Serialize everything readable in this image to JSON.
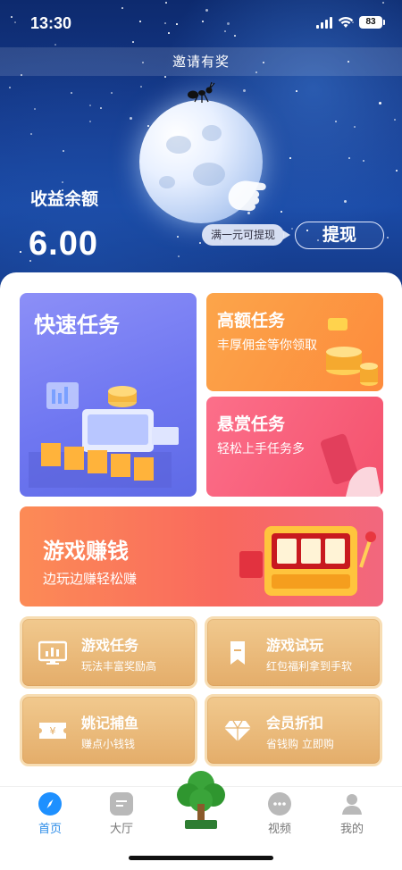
{
  "status_bar": {
    "time": "13:30",
    "battery": "83"
  },
  "header": {
    "invite_text": "邀请有奖"
  },
  "balance": {
    "label": "收益余额",
    "value": "6.00",
    "tip": "满一元可提现",
    "withdraw_label": "提现"
  },
  "cards": {
    "quick": {
      "title": "快速任务"
    },
    "high": {
      "title": "高额任务",
      "subtitle": "丰厚佣金等你领取"
    },
    "reward": {
      "title": "悬赏任务",
      "subtitle": "轻松上手任务多"
    },
    "game": {
      "title": "游戏赚钱",
      "subtitle": "边玩边赚轻松赚"
    }
  },
  "grid": [
    {
      "title": "游戏任务",
      "subtitle": "玩法丰富奖励高",
      "icon": "monitor-chart-icon"
    },
    {
      "title": "游戏试玩",
      "subtitle": "红包福利拿到手软",
      "icon": "bookmark-icon"
    },
    {
      "title": "姚记捕鱼",
      "subtitle": "赚点小钱钱",
      "icon": "ticket-yen-icon"
    },
    {
      "title": "会员折扣",
      "subtitle": "省钱购 立即购",
      "icon": "diamond-icon"
    }
  ],
  "tabbar": {
    "items": [
      {
        "label": "首页",
        "active": true,
        "icon": "compass-icon"
      },
      {
        "label": "大厅",
        "active": false,
        "icon": "chat-bubble-icon"
      },
      {
        "label": "视频",
        "active": false,
        "icon": "more-dots-icon"
      },
      {
        "label": "我的",
        "active": false,
        "icon": "person-icon"
      }
    ],
    "center_icon": "tree-icon"
  },
  "colors": {
    "hero_bg": "#173d91",
    "quick_card": "#7179f2",
    "high_card": "#fd993f",
    "reward_card": "#f65e78",
    "game_card": "#f9725c",
    "gold_card": "#e9b978",
    "tab_active": "#2a8be8"
  }
}
